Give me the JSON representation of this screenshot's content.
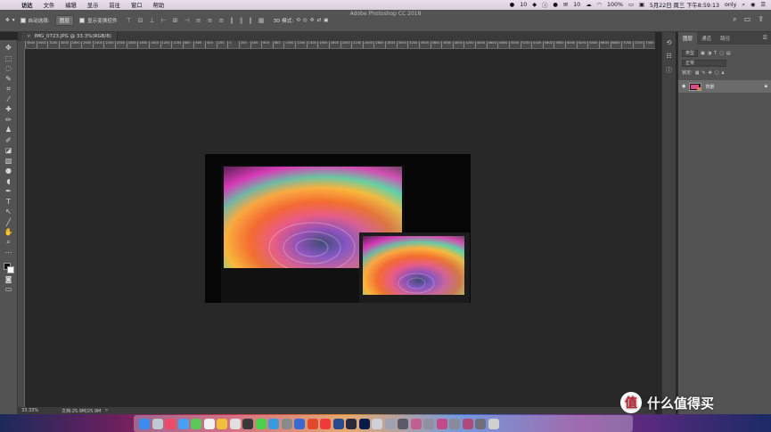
{
  "menubar": {
    "app_name": "访达",
    "items": [
      "文件",
      "编辑",
      "显示",
      "前往",
      "窗口",
      "帮助"
    ],
    "status": {
      "badge_count": "10",
      "wechat_count": "10",
      "battery": "100%",
      "datetime": "5月22日 周三 下午8:59:13",
      "user": "only"
    }
  },
  "optbar": {
    "window_title": "Adobe Photoshop CC 2018",
    "auto_select_label": "自动选择:",
    "auto_select_value": "图层",
    "show_transform_label": "显示变换控件",
    "mode_3d_label": "3D 模式:"
  },
  "document_tab": {
    "title": "IMG_0723.JPG @ 33.3%(RGB/8)",
    "close": "×"
  },
  "ruler": {
    "top_labels": [
      "3600",
      "3400",
      "3200",
      "3000",
      "2800",
      "2600",
      "2400",
      "2200",
      "2000",
      "1800",
      "1600",
      "1400",
      "1200",
      "1000",
      "800",
      "600",
      "400",
      "200",
      "0",
      "200",
      "400",
      "600",
      "800",
      "1000",
      "1200",
      "1400",
      "1600",
      "1800",
      "2000",
      "2200",
      "2400",
      "2600",
      "2800",
      "3000",
      "3200",
      "3400",
      "3600",
      "3800",
      "4000",
      "4200",
      "4400",
      "4600",
      "4800",
      "5000",
      "5200",
      "5400",
      "5600",
      "5800",
      "6000",
      "6200",
      "6400",
      "6600",
      "6800",
      "7000",
      "7200",
      "7400"
    ]
  },
  "status_bar": {
    "zoom": "33.33%",
    "doc_size": "文档:25.9M/25.9M",
    "arrow": ">"
  },
  "panel": {
    "tabs": [
      "图层",
      "通道",
      "路径"
    ],
    "filter_kind": "类型",
    "blend_mode": "正常",
    "lock_label": "锁定:",
    "layer_name": "背景"
  },
  "watermark": {
    "logo_text": "值",
    "text": "什么值得买"
  }
}
